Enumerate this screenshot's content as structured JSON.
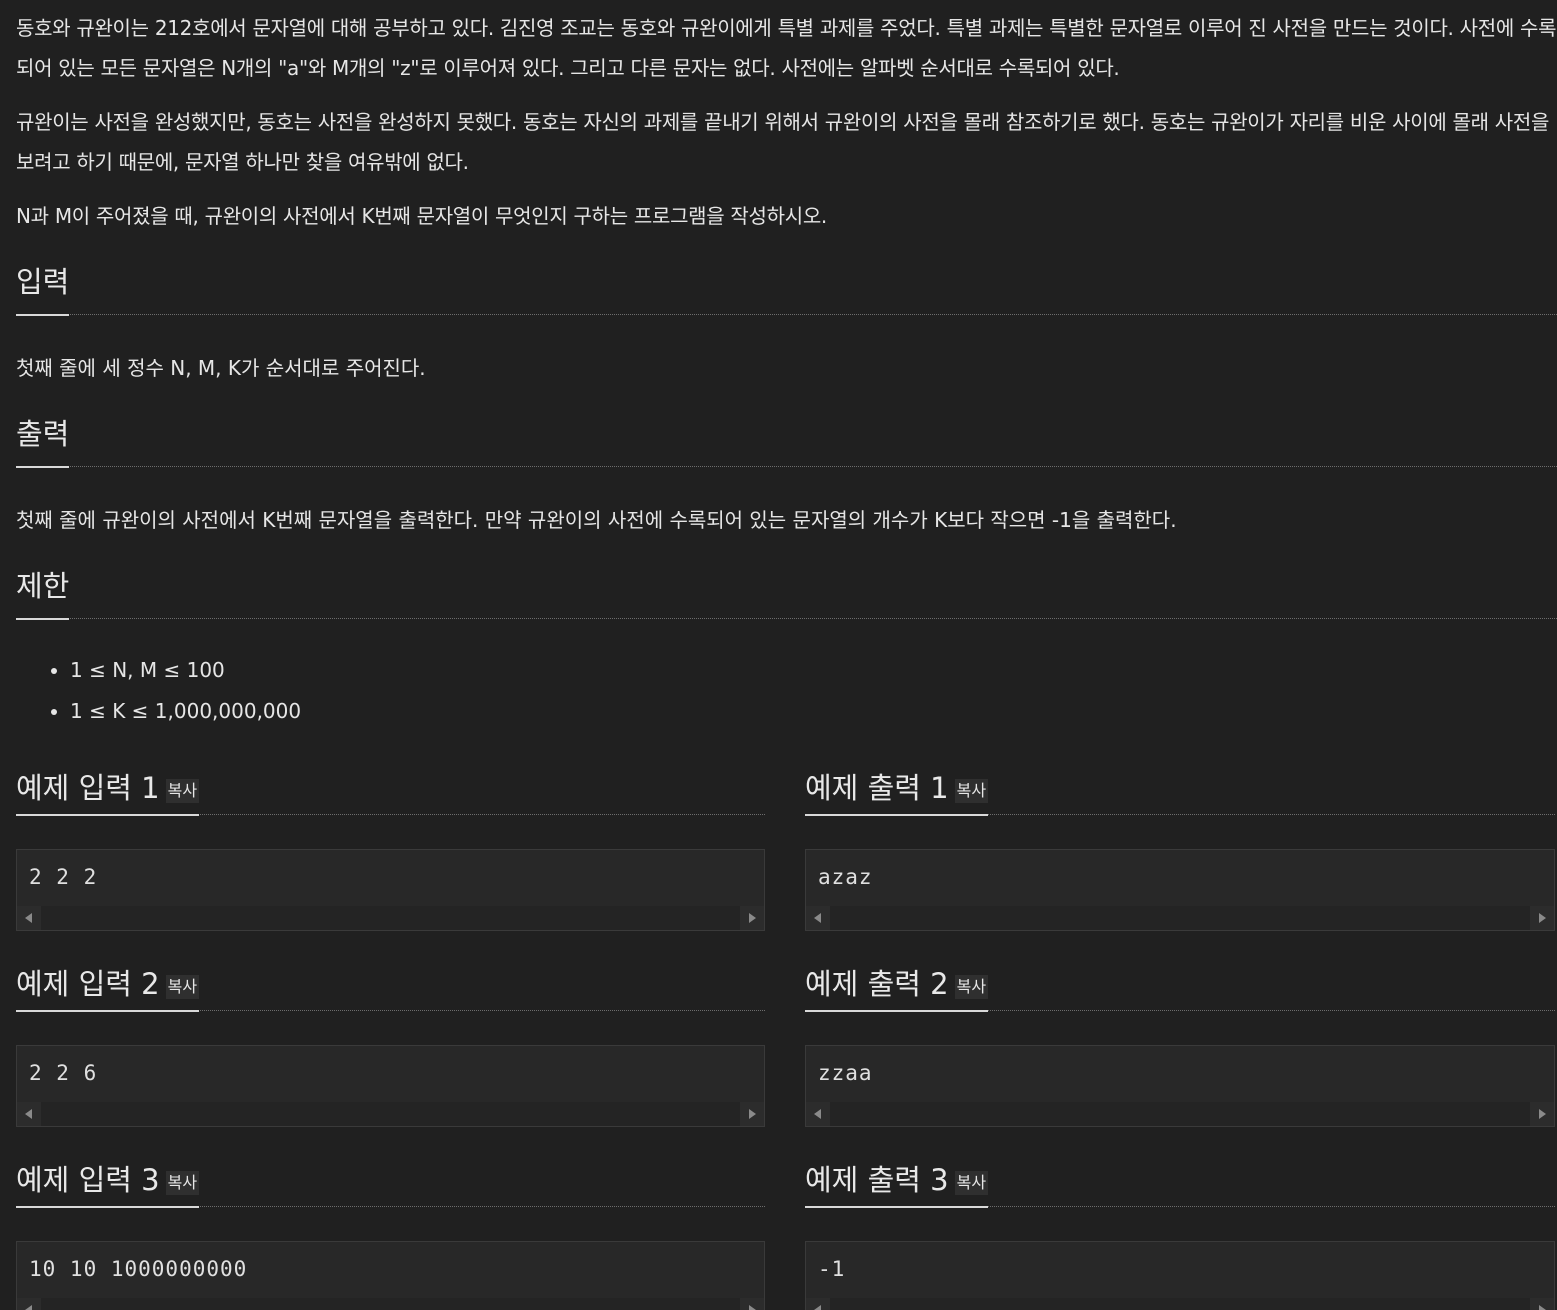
{
  "description": {
    "paragraph1": "동호와 규완이는 212호에서 문자열에 대해 공부하고 있다. 김진영 조교는 동호와 규완이에게 특별 과제를 주었다. 특별 과제는 특별한 문자열로 이루어 진 사전을 만드는 것이다. 사전에 수록되어 있는 모든 문자열은 N개의 \"a\"와 M개의 \"z\"로 이루어져 있다. 그리고 다른 문자는 없다. 사전에는 알파벳 순서대로 수록되어 있다.",
    "paragraph2": "규완이는 사전을 완성했지만, 동호는 사전을 완성하지 못했다. 동호는 자신의 과제를 끝내기 위해서 규완이의 사전을 몰래 참조하기로 했다. 동호는 규완이가 자리를 비운 사이에 몰래 사전을 보려고 하기 때문에, 문자열 하나만 찾을 여유밖에 없다.",
    "paragraph3": "N과 M이 주어졌을 때, 규완이의 사전에서 K번째 문자열이 무엇인지 구하는 프로그램을 작성하시오."
  },
  "input_section": {
    "title": "입력",
    "body": "첫째 줄에 세 정수 N, M, K가 순서대로 주어진다."
  },
  "output_section": {
    "title": "출력",
    "body": "첫째 줄에 규완이의 사전에서 K번째 문자열을 출력한다. 만약 규완이의 사전에 수록되어 있는 문자열의 개수가 K보다 작으면 -1을 출력한다."
  },
  "limit_section": {
    "title": "제한",
    "items": [
      "1 ≤ N, M ≤ 100",
      "1 ≤ K ≤ 1,000,000,000"
    ]
  },
  "copy_label": "복사",
  "examples": [
    {
      "input_title": "예제 입력 1",
      "input_value": "2 2 2",
      "output_title": "예제 출력 1",
      "output_value": "azaz"
    },
    {
      "input_title": "예제 입력 2",
      "input_value": "2 2 6",
      "output_title": "예제 출력 2",
      "output_value": "zzaa"
    },
    {
      "input_title": "예제 입력 3",
      "input_value": "10 10 1000000000",
      "output_title": "예제 출력 3",
      "output_value": "-1"
    }
  ]
}
